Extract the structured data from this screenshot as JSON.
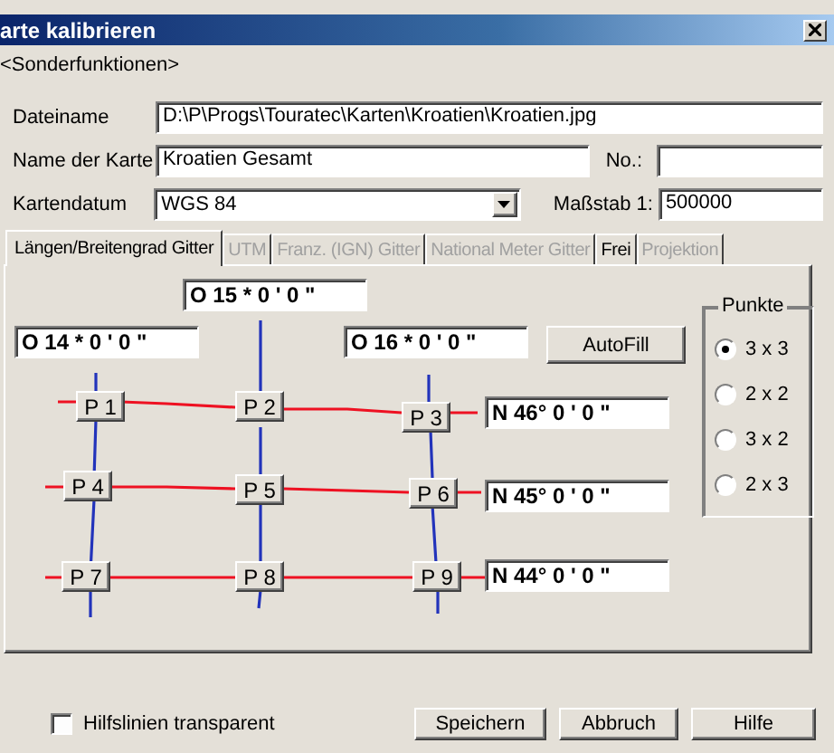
{
  "window": {
    "title": "arte kalibrieren"
  },
  "menu": "<Sonderfunktionen>",
  "form": {
    "file_name": {
      "label": "Dateiname",
      "value": "D:\\P\\Progs\\Touratec\\Karten\\Kroatien\\Kroatien.jpg"
    },
    "map_name": {
      "label": "Name der Karte",
      "value": "Kroatien Gesamt"
    },
    "number": {
      "label": "No.:"
    },
    "datum": {
      "label": "Kartendatum",
      "value": "WGS 84"
    },
    "scale": {
      "label": "Maßstab 1:",
      "value": "500000"
    }
  },
  "tabs": [
    {
      "label": "Längen/Breitengrad Gitter",
      "selected": true,
      "disabled": false
    },
    {
      "label": "UTM",
      "selected": false,
      "disabled": true
    },
    {
      "label": "Franz. (IGN) Gitter",
      "selected": false,
      "disabled": true
    },
    {
      "label": "National Meter Gitter",
      "selected": false,
      "disabled": true
    },
    {
      "label": "Frei",
      "selected": false,
      "disabled": false
    },
    {
      "label": "Projektion",
      "selected": false,
      "disabled": true
    }
  ],
  "grid": {
    "longitudes": [
      "O 14 * 0 ' 0  \"",
      "O 15 * 0 ' 0  \"",
      "O 16 * 0 ' 0  \""
    ],
    "latitudes": [
      "N 46° 0 ' 0  \"",
      "N 45° 0 ' 0  \"",
      "N 44° 0 ' 0  \""
    ],
    "points": [
      "P 1",
      "P 2",
      "P 3",
      "P 4",
      "P 5",
      "P 6",
      "P 7",
      "P 8",
      "P 9"
    ],
    "autofill": "AutoFill"
  },
  "points_group": {
    "title": "Punkte",
    "options": [
      {
        "label": "3 x 3",
        "selected": true
      },
      {
        "label": "2 x 2",
        "selected": false
      },
      {
        "label": "3 x 2",
        "selected": false
      },
      {
        "label": "2 x 3",
        "selected": false
      }
    ]
  },
  "checkbox": {
    "label": "Hilfslinien transparent",
    "checked": false
  },
  "buttons": [
    "Speichern",
    "Abbruch",
    "Hilfe"
  ]
}
